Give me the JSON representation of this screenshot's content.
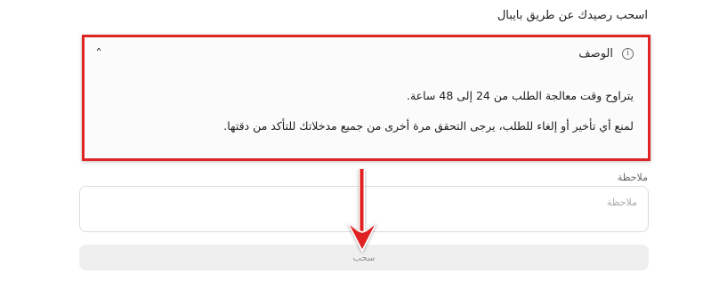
{
  "page": {
    "heading": "اسحب رصيدك عن طريق بايبال"
  },
  "description": {
    "title": "الوصف",
    "info_icon": "info-circle-icon",
    "collapse_icon": "chevron-up-icon",
    "line1": "يتراوح وقت معالجة الطلب من 24 إلى 48 ساعة.",
    "line2": "لمنع أي تأخير أو إلغاء للطلب، يرجى التحقق مرة أخرى من جميع مدخلاتك للتأكد من دقتها."
  },
  "note": {
    "label": "ملاحظة",
    "placeholder": "ملاحظة",
    "value": ""
  },
  "actions": {
    "withdraw_label": "سحب"
  },
  "colors": {
    "annotation_red": "#e02424",
    "button_bg": "#efefef",
    "card_bg": "#fbfbfb"
  }
}
